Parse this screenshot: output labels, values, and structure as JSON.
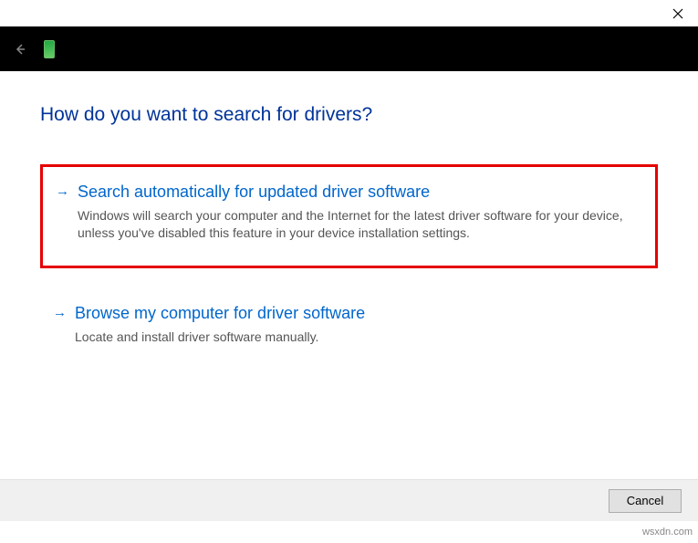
{
  "heading": "How do you want to search for drivers?",
  "options": [
    {
      "title": "Search automatically for updated driver software",
      "description": "Windows will search your computer and the Internet for the latest driver software for your device, unless you've disabled this feature in your device installation settings."
    },
    {
      "title": "Browse my computer for driver software",
      "description": "Locate and install driver software manually."
    }
  ],
  "buttons": {
    "cancel": "Cancel"
  },
  "watermark": "wsxdn.com"
}
